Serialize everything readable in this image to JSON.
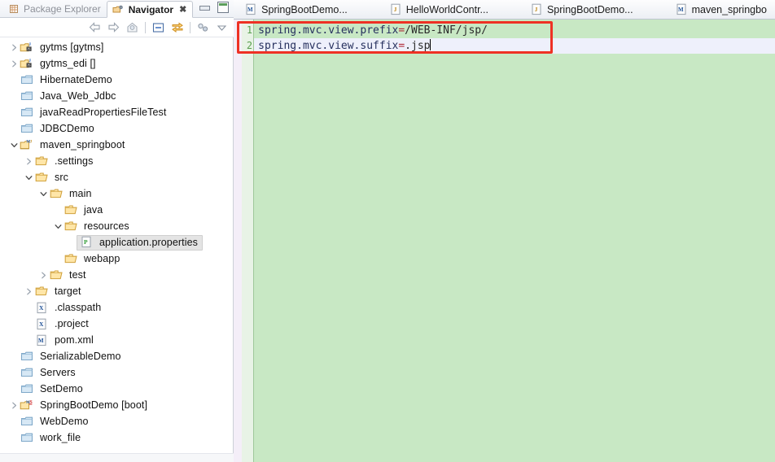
{
  "left_panel": {
    "view_tabs": [
      {
        "label": "Package Explorer",
        "icon": "package-explorer-icon",
        "active": false
      },
      {
        "label": "Navigator",
        "icon": "navigator-icon",
        "active": true,
        "close": "✖"
      }
    ],
    "window_buttons": {
      "minimize": "minimize-button",
      "maximize": "maximize-button"
    },
    "toolbar": [
      {
        "name": "back-icon"
      },
      {
        "name": "forward-icon"
      },
      {
        "name": "home-icon"
      },
      {
        "name": "separator"
      },
      {
        "name": "collapse-all-icon"
      },
      {
        "name": "link-with-editor-icon"
      },
      {
        "name": "separator"
      },
      {
        "name": "view-menu-icon"
      },
      {
        "name": "chevron-down-icon"
      }
    ],
    "tree": [
      {
        "label": "gytms [gytms]",
        "indent": 0,
        "twisty": "collapsed",
        "icon": "java-project-icon"
      },
      {
        "label": "gytms_edi []",
        "indent": 0,
        "twisty": "collapsed",
        "icon": "java-project-icon"
      },
      {
        "label": "HibernateDemo",
        "indent": 0,
        "twisty": "none",
        "icon": "closed-project-icon"
      },
      {
        "label": "Java_Web_Jdbc",
        "indent": 0,
        "twisty": "none",
        "icon": "closed-project-icon"
      },
      {
        "label": "javaReadPropertiesFileTest",
        "indent": 0,
        "twisty": "none",
        "icon": "closed-project-icon"
      },
      {
        "label": "JDBCDemo",
        "indent": 0,
        "twisty": "none",
        "icon": "closed-project-icon"
      },
      {
        "label": "maven_springboot",
        "indent": 0,
        "twisty": "expanded",
        "icon": "maven-project-icon"
      },
      {
        "label": ".settings",
        "indent": 1,
        "twisty": "collapsed",
        "icon": "folder-icon"
      },
      {
        "label": "src",
        "indent": 1,
        "twisty": "expanded",
        "icon": "folder-icon"
      },
      {
        "label": "main",
        "indent": 2,
        "twisty": "expanded",
        "icon": "folder-icon"
      },
      {
        "label": "java",
        "indent": 3,
        "twisty": "none",
        "icon": "folder-icon"
      },
      {
        "label": "resources",
        "indent": 3,
        "twisty": "expanded",
        "icon": "folder-icon"
      },
      {
        "label": "application.properties",
        "indent": 4,
        "twisty": "none",
        "icon": "properties-file-icon",
        "selected": true
      },
      {
        "label": "webapp",
        "indent": 3,
        "twisty": "none",
        "icon": "folder-icon"
      },
      {
        "label": "test",
        "indent": 2,
        "twisty": "collapsed",
        "icon": "folder-icon"
      },
      {
        "label": "target",
        "indent": 1,
        "twisty": "collapsed",
        "icon": "folder-icon"
      },
      {
        "label": ".classpath",
        "indent": 1,
        "twisty": "none",
        "icon": "xml-file-icon"
      },
      {
        "label": ".project",
        "indent": 1,
        "twisty": "none",
        "icon": "xml-file-icon"
      },
      {
        "label": "pom.xml",
        "indent": 1,
        "twisty": "none",
        "icon": "maven-pom-icon"
      },
      {
        "label": "SerializableDemo",
        "indent": 0,
        "twisty": "none",
        "icon": "closed-project-icon"
      },
      {
        "label": "Servers",
        "indent": 0,
        "twisty": "none",
        "icon": "closed-project-icon"
      },
      {
        "label": "SetDemo",
        "indent": 0,
        "twisty": "none",
        "icon": "closed-project-icon"
      },
      {
        "label": "SpringBootDemo [boot]",
        "indent": 0,
        "twisty": "collapsed",
        "icon": "spring-project-icon"
      },
      {
        "label": "WebDemo",
        "indent": 0,
        "twisty": "none",
        "icon": "closed-project-icon"
      },
      {
        "label": "work_file",
        "indent": 0,
        "twisty": "none",
        "icon": "closed-project-icon"
      }
    ]
  },
  "editor": {
    "tabs": [
      {
        "label": "SpringBootDemo...",
        "icon": "maven-pom-icon",
        "icon_letter": "M",
        "active": false
      },
      {
        "label": "HelloWorldContr...",
        "icon": "java-file-icon",
        "icon_letter": "J",
        "active": false
      },
      {
        "label": "SpringBootDemo...",
        "icon": "java-file-icon",
        "icon_letter": "J",
        "active": false
      },
      {
        "label": "maven_springbo",
        "icon": "maven-pom-icon",
        "icon_letter": "M",
        "active": false
      }
    ],
    "line_numbers": [
      "1",
      "2"
    ],
    "lines": [
      {
        "key": "spring.mvc.view.prefix",
        "eq": "=",
        "value": "/WEB-INF/jsp/",
        "current": false
      },
      {
        "key": "spring.mvc.view.suffix",
        "eq": "=",
        "value": ".jsp",
        "current": true
      }
    ],
    "highlight_color": "#ee3124",
    "background_color": "#c8e8c4"
  }
}
